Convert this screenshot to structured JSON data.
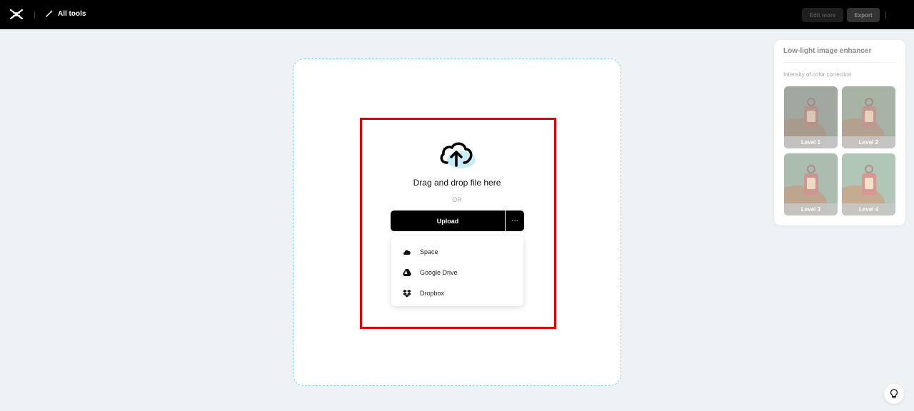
{
  "topbar": {
    "all_tools_label": "All tools",
    "edit_more_label": "Edit more",
    "export_label": "Export"
  },
  "dropzone": {
    "drag_text": "Drag and drop file here",
    "or_text": "OR",
    "upload_label": "Upload",
    "more_label": "···",
    "menu": [
      {
        "label": "Space",
        "icon": "cloud-icon"
      },
      {
        "label": "Google Drive",
        "icon": "google-drive-icon"
      },
      {
        "label": "Dropbox",
        "icon": "dropbox-icon"
      }
    ]
  },
  "panel": {
    "title": "Low-light image enhancer",
    "subtitle": "Intensity of color correction",
    "levels": [
      {
        "label": "Level 1"
      },
      {
        "label": "Level 2"
      },
      {
        "label": "Level 3"
      },
      {
        "label": "Level 4"
      }
    ]
  },
  "colors": {
    "accent_cyan": "#7fd6e6",
    "highlight_red": "#e00000",
    "topbar_bg": "#000000"
  }
}
